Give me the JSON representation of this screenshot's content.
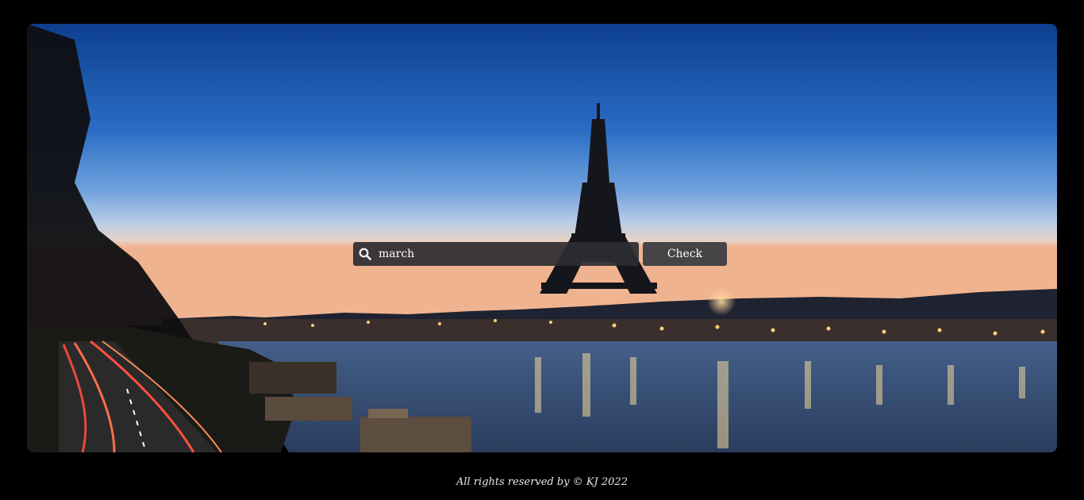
{
  "search": {
    "value": "march",
    "icon": "search-icon"
  },
  "check_button": {
    "label": "Check"
  },
  "hero": {
    "image": "paris-eiffel-tower-seine-dusk"
  },
  "footer": {
    "text": "All rights reserved by © KJ 2022"
  }
}
